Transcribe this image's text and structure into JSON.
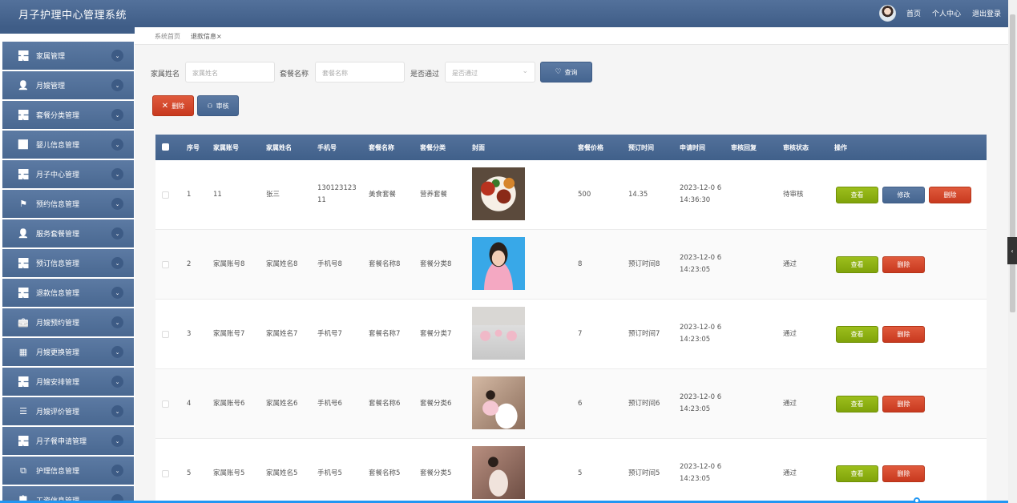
{
  "header": {
    "app_title": "月子护理中心管理系统",
    "links": [
      "首页",
      "个人中心",
      "退出登录"
    ]
  },
  "sidebar": {
    "items": [
      {
        "label": "家属管理",
        "icon": "grid-icon"
      },
      {
        "label": "月嫂管理",
        "icon": "user-icon"
      },
      {
        "label": "套餐分类管理",
        "icon": "grid-icon"
      },
      {
        "label": "婴儿信息管理",
        "icon": "chart-icon"
      },
      {
        "label": "月子中心管理",
        "icon": "grid-icon"
      },
      {
        "label": "预约信息管理",
        "icon": "flag-icon"
      },
      {
        "label": "服务套餐管理",
        "icon": "user-icon"
      },
      {
        "label": "预订信息管理",
        "icon": "grid-icon"
      },
      {
        "label": "退款信息管理",
        "icon": "grid-icon"
      },
      {
        "label": "月嫂预约管理",
        "icon": "briefcase-icon"
      },
      {
        "label": "月嫂更换管理",
        "icon": "apps-icon"
      },
      {
        "label": "月嫂安排管理",
        "icon": "grid-icon"
      },
      {
        "label": "月嫂评价管理",
        "icon": "sliders-icon"
      },
      {
        "label": "月子餐申请管理",
        "icon": "grid-icon"
      },
      {
        "label": "护理信息管理",
        "icon": "bookmark-icon"
      },
      {
        "label": "工资信息管理",
        "icon": "clipboard-icon"
      }
    ]
  },
  "tabs": {
    "home": "系统首页",
    "current": "退款信息",
    "close": "×"
  },
  "search": {
    "name_label": "家属姓名",
    "name_placeholder": "家属姓名",
    "package_label": "套餐名称",
    "package_placeholder": "套餐名称",
    "pass_label": "是否通过",
    "pass_placeholder": "是否通过",
    "query_button": "查询"
  },
  "actions": {
    "delete": "删除",
    "review": "审核"
  },
  "table": {
    "columns": [
      "序号",
      "家属账号",
      "家属姓名",
      "手机号",
      "套餐名称",
      "套餐分类",
      "封面",
      "套餐价格",
      "预订时间",
      "申请时间",
      "审核回复",
      "审核状态",
      "操作"
    ],
    "rows": [
      {
        "index": "1",
        "account": "11",
        "name": "张三",
        "phone": "130123123 11",
        "package": "美食套餐",
        "category": "营养套餐",
        "cover": "food-photo",
        "price": "500",
        "booking_time": "14.35",
        "apply_time": "2023-12-0 6 14:36:30",
        "reply": "",
        "status": "待审核",
        "ops": [
          "查看",
          "修改",
          "删除"
        ]
      },
      {
        "index": "2",
        "account": "家属账号8",
        "name": "家属姓名8",
        "phone": "手机号8",
        "package": "套餐名称8",
        "category": "套餐分类8",
        "cover": "portrait-photo",
        "price": "8",
        "booking_time": "预订时间8",
        "apply_time": "2023-12-0 6 14:23:05",
        "reply": "",
        "status": "通过",
        "ops": [
          "查看",
          "删除"
        ]
      },
      {
        "index": "3",
        "account": "家属账号7",
        "name": "家属姓名7",
        "phone": "手机号7",
        "package": "套餐名称7",
        "category": "套餐分类7",
        "cover": "classroom-photo",
        "price": "7",
        "booking_time": "预订时间7",
        "apply_time": "2023-12-0 6 14:23:05",
        "reply": "",
        "status": "通过",
        "ops": [
          "查看",
          "删除"
        ]
      },
      {
        "index": "4",
        "account": "家属账号6",
        "name": "家属姓名6",
        "phone": "手机号6",
        "package": "套餐名称6",
        "category": "套餐分类6",
        "cover": "nursing-photo",
        "price": "6",
        "booking_time": "预订时间6",
        "apply_time": "2023-12-0 6 14:23:05",
        "reply": "",
        "status": "通过",
        "ops": [
          "查看",
          "删除"
        ]
      },
      {
        "index": "5",
        "account": "家属账号5",
        "name": "家属姓名5",
        "phone": "手机号5",
        "package": "套餐名称5",
        "category": "套餐分类5",
        "cover": "baby-care-photo",
        "price": "5",
        "booking_time": "预订时间5",
        "apply_time": "2023-12-0 6 14:23:05",
        "reply": "",
        "status": "通过",
        "ops": [
          "查看",
          "删除"
        ]
      }
    ]
  },
  "colors": {
    "primary": "#4a6a94",
    "danger": "#d9472b",
    "success": "#8cb012"
  }
}
